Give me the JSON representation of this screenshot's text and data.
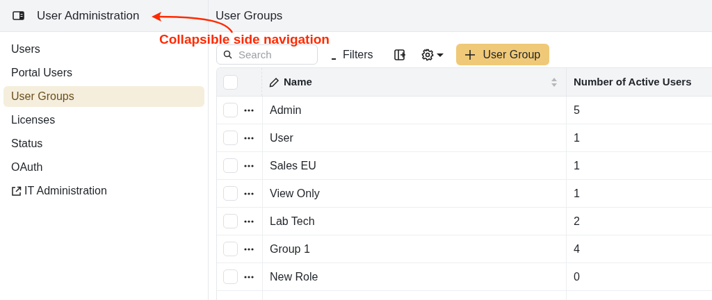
{
  "header": {
    "app_title": "User Administration",
    "page_title": "User Groups"
  },
  "annotation": {
    "label": "Collapsible side navigation"
  },
  "sidebar": {
    "items": [
      {
        "label": "Users",
        "selected": false,
        "kind": "link"
      },
      {
        "label": "Portal Users",
        "selected": false,
        "kind": "link"
      },
      {
        "label": "User Groups",
        "selected": true,
        "kind": "link"
      },
      {
        "label": "Licenses",
        "selected": false,
        "kind": "link"
      },
      {
        "label": "Status",
        "selected": false,
        "kind": "link"
      },
      {
        "label": "OAuth",
        "selected": false,
        "kind": "link"
      },
      {
        "label": "IT Administration",
        "selected": false,
        "kind": "external"
      }
    ]
  },
  "toolbar": {
    "search": {
      "placeholder": "Search"
    },
    "filters": "Filters",
    "add_button": "User Group"
  },
  "table": {
    "header_checked": false,
    "columns": [
      "Name",
      "Number of Active Users"
    ],
    "rows": [
      {
        "name": "Admin",
        "active_users": "5",
        "checked": false
      },
      {
        "name": "User",
        "active_users": "1",
        "checked": false
      },
      {
        "name": "Sales EU",
        "active_users": "1",
        "checked": false
      },
      {
        "name": "View Only",
        "active_users": "1",
        "checked": false
      },
      {
        "name": "Lab Tech",
        "active_users": "2",
        "checked": false
      },
      {
        "name": "Group 1",
        "active_users": "4",
        "checked": false
      },
      {
        "name": "New Role",
        "active_users": "0",
        "checked": false
      }
    ]
  }
}
